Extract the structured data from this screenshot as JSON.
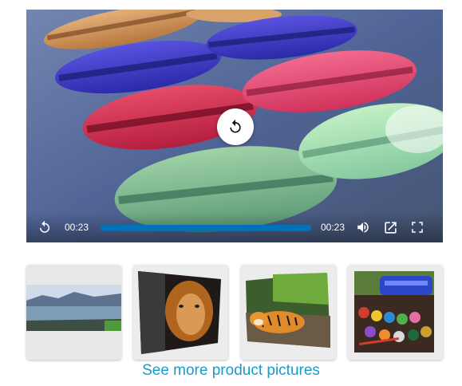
{
  "player": {
    "current_time": "00:23",
    "duration": "00:23",
    "progress": 1.0,
    "icons": {
      "replay_center": "replay-icon",
      "replay_small": "replay-icon",
      "volume": "volume-icon",
      "popout": "external-link-icon",
      "fullscreen": "fullscreen-icon"
    },
    "progress_color": "#0072bc"
  },
  "gallery": {
    "thumbnails": [
      {
        "subject": "lake-landscape-panorama"
      },
      {
        "subject": "lion-canvas"
      },
      {
        "subject": "tiger-canvas"
      },
      {
        "subject": "paint-pots-canvas"
      }
    ],
    "more_link": "See more product pictures",
    "link_color": "#1a9bc9"
  }
}
